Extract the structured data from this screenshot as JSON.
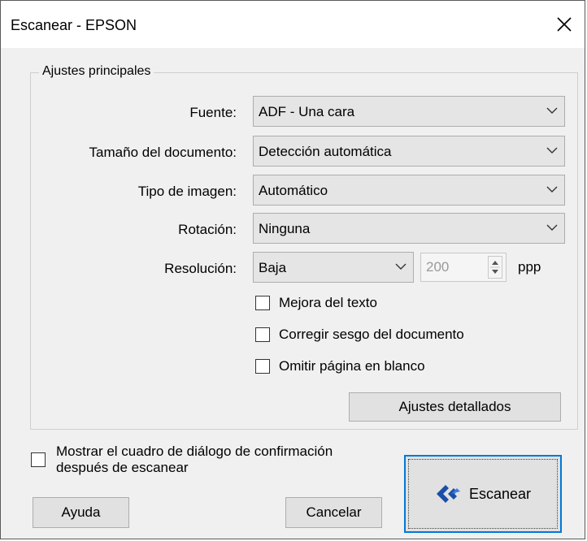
{
  "window": {
    "title": "Escanear - EPSON"
  },
  "group": {
    "label": "Ajustes principales"
  },
  "fields": {
    "source": {
      "label": "Fuente:",
      "value": "ADF - Una cara"
    },
    "doc_size": {
      "label": "Tamaño del documento:",
      "value": "Detección automática"
    },
    "image_type": {
      "label": "Tipo de imagen:",
      "value": "Automático"
    },
    "rotation": {
      "label": "Rotación:",
      "value": "Ninguna"
    },
    "resolution": {
      "label": "Resolución:",
      "value": "Baja",
      "spin_value": "200",
      "unit": "ppp"
    }
  },
  "options": {
    "text_enhance": {
      "label": "Mejora del texto",
      "checked": false
    },
    "deskew": {
      "label": "Corregir sesgo del documento",
      "checked": false
    },
    "skip_blank": {
      "label": "Omitir página en blanco",
      "checked": false
    }
  },
  "buttons": {
    "detailed": "Ajustes detallados",
    "help": "Ayuda",
    "cancel": "Cancelar",
    "scan": "Escanear"
  },
  "confirm": {
    "line1": "Mostrar el cuadro de diálogo de confirmación",
    "line2": "después de escanear",
    "checked": false
  },
  "colors": {
    "accent": "#0078d7",
    "brand": "#1a4fa8"
  }
}
